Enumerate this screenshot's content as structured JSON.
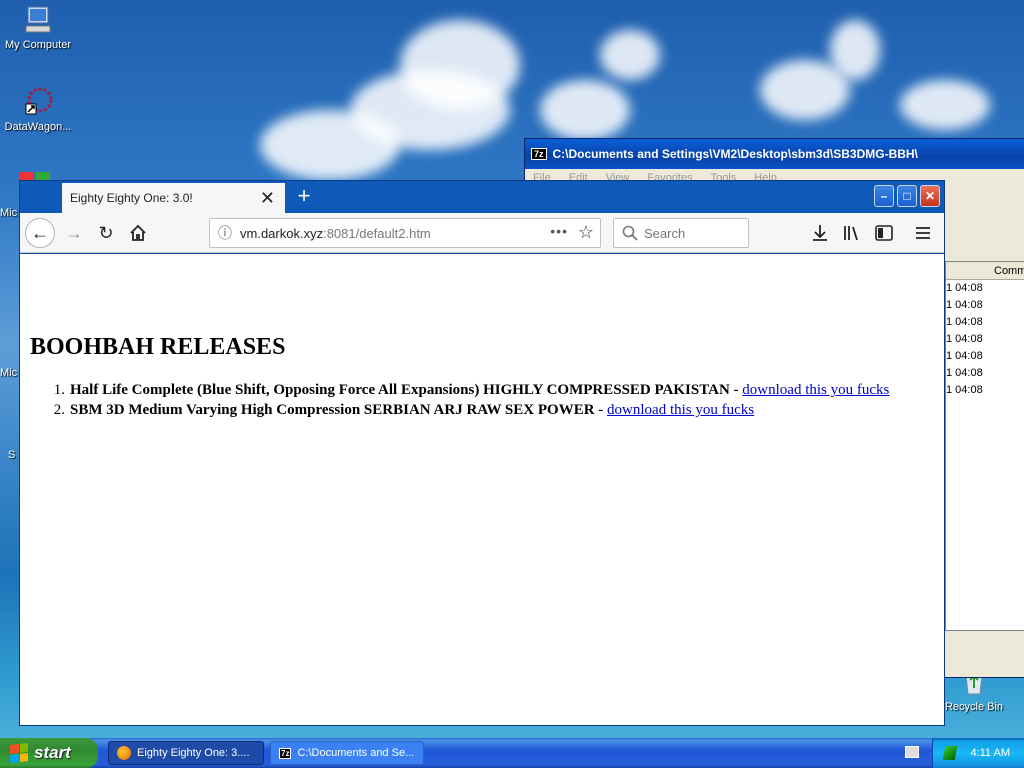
{
  "desktop": {
    "icons": [
      {
        "label": "My Computer",
        "icon": "computer-icon"
      },
      {
        "label": "DataWagon...",
        "icon": "datawagon-icon"
      },
      {
        "label": "Recycle Bin",
        "icon": "recycle-bin-icon"
      }
    ],
    "partial_labels": [
      "Mic",
      "Mic",
      "S"
    ]
  },
  "zip_window": {
    "badge": "7z",
    "title": "C:\\Documents and Settings\\VM2\\Desktop\\sbm3d\\SB3DMG-BBH\\",
    "menu": [
      "File",
      "Edit",
      "View",
      "Favorites",
      "Tools",
      "Help"
    ],
    "column_header": "Comm",
    "rows": [
      "1 04:08",
      "1 04:08",
      "1 04:08",
      "1 04:08",
      "1 04:08",
      "1 04:08",
      "1 04:08"
    ]
  },
  "browser": {
    "tab_title": "Eighty Eighty One: 3.0!",
    "tab_close": "✕",
    "new_tab": "+",
    "url_host": "vm.darkok.xyz",
    "url_rest": ":8081/default2.htm",
    "url_info_icon": "ⓘ",
    "url_dots": "•••",
    "search_placeholder": "Search",
    "window_buttons": {
      "minimize": "–",
      "maximize": "□",
      "close": "✕"
    }
  },
  "page": {
    "heading": "BOOHBAH RELEASES",
    "items": [
      {
        "num": "1.",
        "text": "Half Life Complete (Blue Shift, Opposing Force All Expansions) HIGHLY COMPRESSED PAKISTAN",
        "sep": " - ",
        "link": "download this you fucks"
      },
      {
        "num": "2.",
        "text": "SBM 3D Medium Varying High Compression SERBIAN ARJ RAW SEX POWER",
        "sep": " - ",
        "link": "download this you fucks"
      }
    ]
  },
  "taskbar": {
    "start_label": "start",
    "buttons": [
      {
        "label": "Eighty Eighty One: 3....",
        "icon": "firefox-icon"
      },
      {
        "label": "C:\\Documents and Se...",
        "icon": "7z-icon"
      }
    ],
    "clock": "4:11 AM"
  },
  "colors": {
    "link": "#0000cc",
    "taskbar": "#245edb",
    "start_green": "#3aa33a",
    "title_blue": "#0f5ab8"
  }
}
